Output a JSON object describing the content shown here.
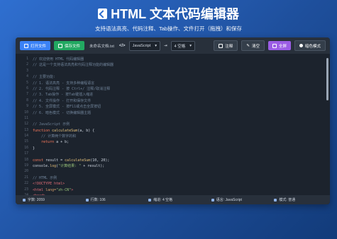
{
  "header": {
    "title": "HTML 文本代码编辑器",
    "subtitle": "支持语法高亮、代码注释、Tab操作、文件打开（拖拽）和保存"
  },
  "toolbar": {
    "open_label": "打开文件",
    "save_label": "保存文件",
    "filename": "未命名文档.txt",
    "lang_icon": "</>",
    "language": "JavaScript",
    "tab_size": "4 空格",
    "comment_label": "注释",
    "clear_label": "清空",
    "fullscreen_label": "全屏",
    "dark_label": "暗色模式"
  },
  "code_lines": [
    [
      {
        "c": "c-cm",
        "t": "// 欢迎使用 HTML 代码编辑器"
      }
    ],
    [
      {
        "c": "c-cm",
        "t": "// 这是一个支持语法高亮和代码注释功能的编辑器"
      }
    ],
    [
      {
        "c": "c-tx",
        "t": ""
      }
    ],
    [
      {
        "c": "c-cm",
        "t": "// 主要功能:"
      }
    ],
    [
      {
        "c": "c-cm",
        "t": "// 1. 语法高亮 - 支持多种编程语言"
      }
    ],
    [
      {
        "c": "c-cm",
        "t": "// 2. 代码注释 - 按 Ctrl+/ 注释/取消注释"
      }
    ],
    [
      {
        "c": "c-cm",
        "t": "// 3. Tab操作 - 按Tab键插入缩进"
      }
    ],
    [
      {
        "c": "c-cm",
        "t": "// 4. 文件操作 - 打开和保存文件"
      }
    ],
    [
      {
        "c": "c-cm",
        "t": "// 5. 全屏模式 - 按F11或点击全屏按钮"
      }
    ],
    [
      {
        "c": "c-cm",
        "t": "// 6. 暗色模式 - 切换编辑器主题"
      }
    ],
    [
      {
        "c": "c-tx",
        "t": ""
      }
    ],
    [
      {
        "c": "c-cm",
        "t": "// JavaScript 示例"
      }
    ],
    [
      {
        "c": "c-kw",
        "t": "function "
      },
      {
        "c": "c-fn",
        "t": "calculateSum"
      },
      {
        "c": "c-tx",
        "t": "(a, b) {"
      }
    ],
    [
      {
        "c": "c-cm",
        "t": "    // 计算两个数字的和"
      }
    ],
    [
      {
        "c": "c-kw",
        "t": "    return "
      },
      {
        "c": "c-tx",
        "t": "a + b;"
      }
    ],
    [
      {
        "c": "c-tx",
        "t": "}"
      }
    ],
    [
      {
        "c": "c-tx",
        "t": ""
      }
    ],
    [
      {
        "c": "c-kw",
        "t": "const "
      },
      {
        "c": "c-tx",
        "t": "result = "
      },
      {
        "c": "c-fn",
        "t": "calculateSum"
      },
      {
        "c": "c-tx",
        "t": "(10, 20);"
      }
    ],
    [
      {
        "c": "c-tx",
        "t": "console."
      },
      {
        "c": "c-fn",
        "t": "log"
      },
      {
        "c": "c-tx",
        "t": "("
      },
      {
        "c": "c-st",
        "t": "\"计算结果: \""
      },
      {
        "c": "c-tx",
        "t": " + result);"
      }
    ],
    [
      {
        "c": "c-tx",
        "t": ""
      }
    ],
    [
      {
        "c": "c-cm",
        "t": "// HTML 示例"
      }
    ],
    [
      {
        "c": "c-tg",
        "t": "<!DOCTYPE html>"
      }
    ],
    [
      {
        "c": "c-tg",
        "t": "<html "
      },
      {
        "c": "c-at",
        "t": "lang="
      },
      {
        "c": "c-st",
        "t": "\"zh-CN\""
      },
      {
        "c": "c-tg",
        "t": ">"
      }
    ],
    [
      {
        "c": "c-tg",
        "t": "<head>"
      }
    ],
    [
      {
        "c": "c-tg",
        "t": "    <meta "
      },
      {
        "c": "c-at",
        "t": "charset="
      },
      {
        "c": "c-st",
        "t": "\"UTF-8\""
      },
      {
        "c": "c-tg",
        "t": ">"
      }
    ]
  ],
  "status": {
    "chars": "字数: 2059",
    "lines": "行数: 106",
    "indent": "缩进: 4 空格",
    "language": "语言: JavaScript",
    "mode": "模式: 普通"
  }
}
